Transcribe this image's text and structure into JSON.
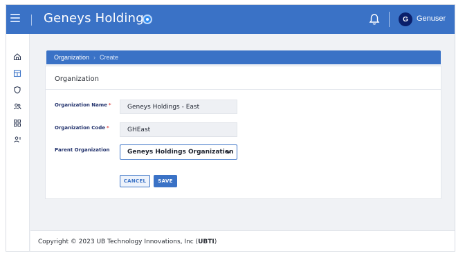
{
  "header": {
    "title": "Geneys Holdings",
    "menu_icon": "hamburger-icon",
    "badge_icon": "brand-badge-icon",
    "bell_icon": "bell-icon",
    "avatar_initial": "G",
    "username": "Genuser",
    "accent": "#3a72c6"
  },
  "sidebar": {
    "items": [
      {
        "icon": "home-icon"
      },
      {
        "icon": "building-icon"
      },
      {
        "icon": "shield-icon"
      },
      {
        "icon": "users-icon"
      },
      {
        "icon": "grid-icon"
      },
      {
        "icon": "user-settings-icon"
      }
    ]
  },
  "breadcrumb": {
    "root": "Organization",
    "separator": "›",
    "current": "Create"
  },
  "form": {
    "title": "Organization",
    "fields": {
      "name": {
        "label": "Organization Name",
        "required": "*",
        "value": "Geneys Holdings - East"
      },
      "code": {
        "label": "Organization Code",
        "required": "*",
        "value": "GHEast"
      },
      "parent": {
        "label": "Parent Organization",
        "value": "Geneys Holdings Organization"
      }
    },
    "cancel_label": "CANCEL",
    "save_label": "SAVE"
  },
  "footer": {
    "text": "Copyright © 2023 UB Technology Innovations, Inc (",
    "bold": "UBTI",
    "close": ")"
  }
}
